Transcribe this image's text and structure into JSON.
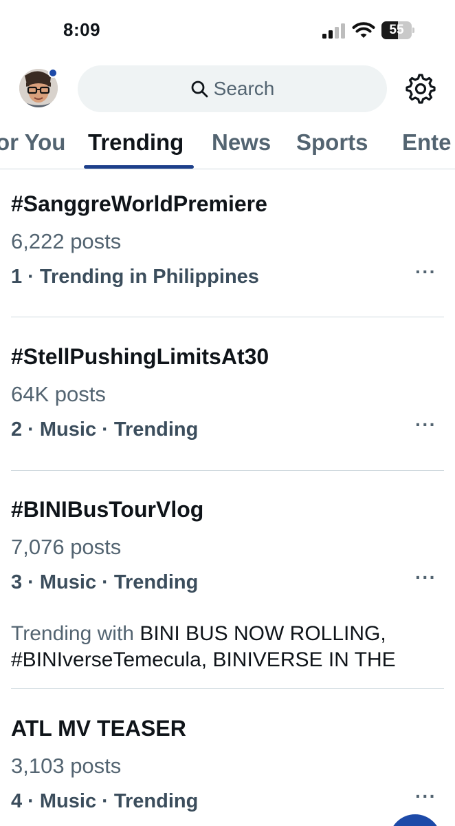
{
  "status_bar": {
    "time": "8:09",
    "battery_level": "55"
  },
  "header": {
    "search_placeholder": "Search",
    "icons": [
      "avatar",
      "search-icon",
      "settings-gear-icon"
    ],
    "notification_dot_color": "#1d4aa8"
  },
  "tabs": [
    {
      "label": "or You"
    },
    {
      "label": "Trending"
    },
    {
      "label": "News"
    },
    {
      "label": "Sports"
    },
    {
      "label": "Ente"
    }
  ],
  "active_tab": "Trending",
  "trends": [
    {
      "title": "#SanggreWorldPremiere",
      "count": "6,222 posts",
      "meta": "1 · Trending in Philippines"
    },
    {
      "title": "#StellPushingLimitsAt30",
      "count": "64K posts",
      "meta": "2 · Music · Trending"
    },
    {
      "title": "#BINIBusTourVlog",
      "count": "7,076 posts",
      "meta": "3 · Music · Trending",
      "trending_with_prefix": "Trending with ",
      "trending_with": "BINI BUS NOW ROLLING, #BINIverseTemecula, BINIVERSE IN THE"
    },
    {
      "title": "ATL MV TEASER",
      "count": "3,103 posts",
      "meta": "4 · Music · Trending"
    }
  ],
  "more_label": "···",
  "colors": {
    "accent": "#1d3f8a",
    "secondary_text": "#536471",
    "primary_text": "#0f1419"
  }
}
